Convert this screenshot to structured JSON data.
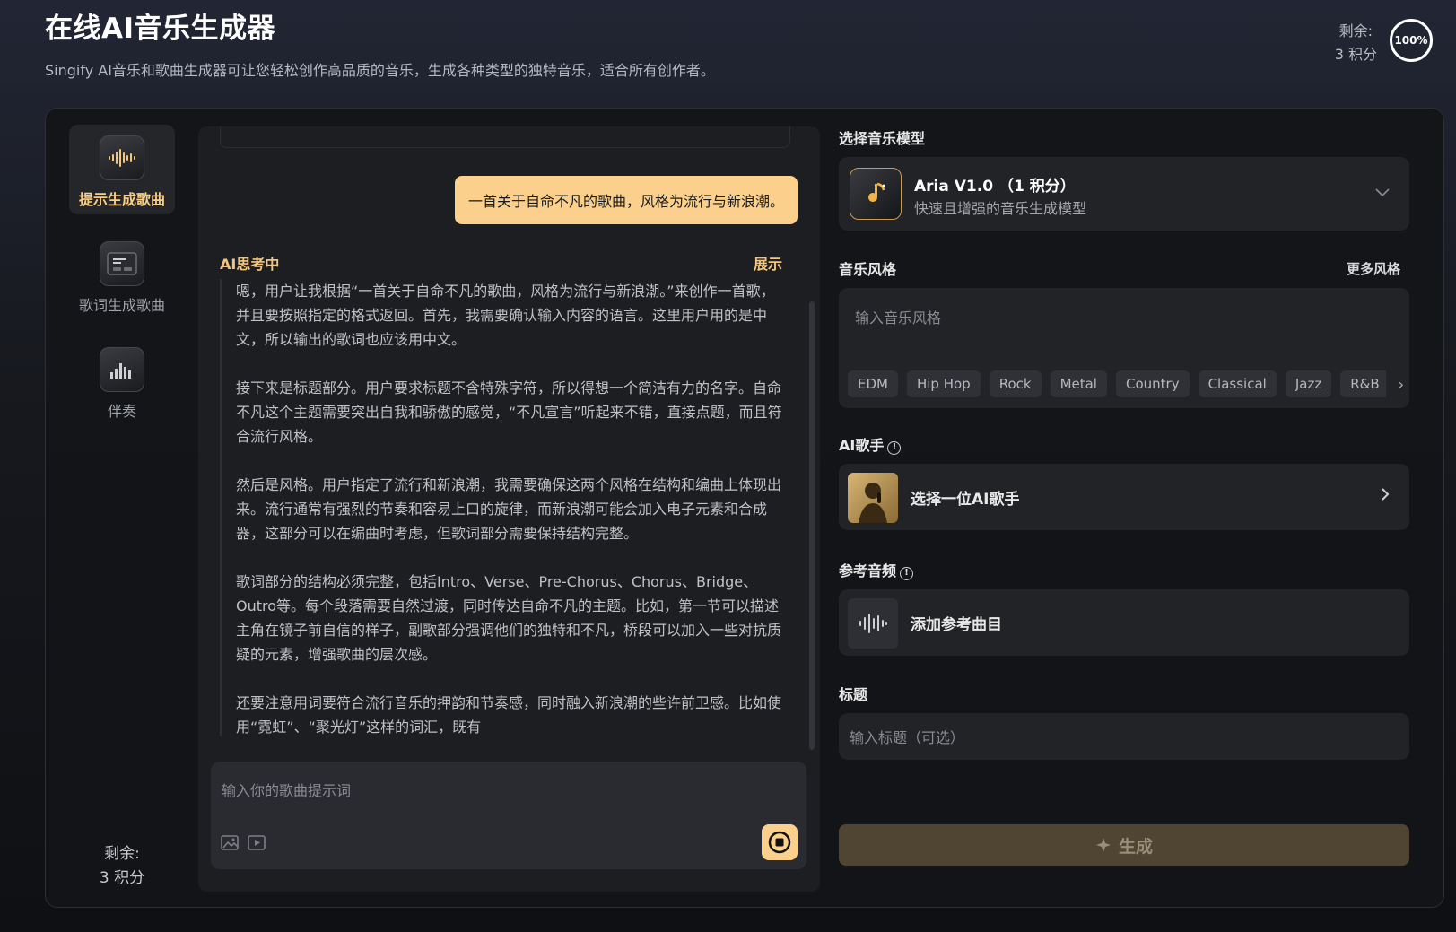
{
  "header": {
    "title": "在线AI音乐生成器",
    "subtitle": "Singify AI音乐和歌曲生成器可让您轻松创作高品质的音乐，生成各种类型的独特音乐，适合所有创作者。",
    "credit_label": "剩余:",
    "credit_value": "3 积分",
    "usage_percent": "100%"
  },
  "nav": {
    "items": [
      {
        "label": "提示生成歌曲"
      },
      {
        "label": "歌词生成歌曲"
      },
      {
        "label": "伴奏"
      }
    ],
    "credit_label": "剩余:",
    "credit_value": "3 积分"
  },
  "chat": {
    "user_message": "一首关于自命不凡的歌曲，风格为流行与新浪潮。",
    "thinking_label": "AI思考中",
    "toggle_label": "展示",
    "thinking_paragraphs": [
      "嗯，用户让我根据“一首关于自命不凡的歌曲，风格为流行与新浪潮。”来创作一首歌，并且要按照指定的格式返回。首先，我需要确认输入内容的语言。这里用户用的是中文，所以输出的歌词也应该用中文。",
      "接下来是标题部分。用户要求标题不含特殊字符，所以得想一个简洁有力的名字。自命不凡这个主题需要突出自我和骄傲的感觉，“不凡宣言”听起来不错，直接点题，而且符合流行风格。",
      "然后是风格。用户指定了流行和新浪潮，我需要确保这两个风格在结构和编曲上体现出来。流行通常有强烈的节奏和容易上口的旋律，而新浪潮可能会加入电子元素和合成器，这部分可以在编曲时考虑，但歌词部分需要保持结构完整。",
      "歌词部分的结构必须完整，包括Intro、Verse、Pre-Chorus、Chorus、Bridge、Outro等。每个段落需要自然过渡，同时传达自命不凡的主题。比如，第一节可以描述主角在镜子前自信的样子，副歌部分强调他们的独特和不凡，桥段可以加入一些对抗质疑的元素，增强歌曲的层次感。",
      "还要注意用词要符合流行音乐的押韵和节奏感，同时融入新浪潮的些许前卫感。比如使用“霓虹”、“聚光灯”这样的词汇，既有"
    ],
    "input_placeholder": "输入你的歌曲提示词"
  },
  "settings": {
    "model_section": "选择音乐模型",
    "model_name": "Aria V1.0 （1 积分）",
    "model_desc": "快速且增强的音乐生成模型",
    "style_section": "音乐风格",
    "more_styles": "更多风格",
    "style_placeholder": "输入音乐风格",
    "style_tags": [
      "EDM",
      "Hip Hop",
      "Rock",
      "Metal",
      "Country",
      "Classical",
      "Jazz",
      "R&B"
    ],
    "singer_section": "AI歌手",
    "singer_select": "选择一位AI歌手",
    "ref_section": "参考音频",
    "ref_add": "添加参考曲目",
    "title_section": "标题",
    "title_placeholder": "输入标题（可选）",
    "generate_label": "生成"
  },
  "colors": {
    "accent": "#fbd08c",
    "accent_text": "#f2c67e",
    "generate_bg": "#504532"
  }
}
